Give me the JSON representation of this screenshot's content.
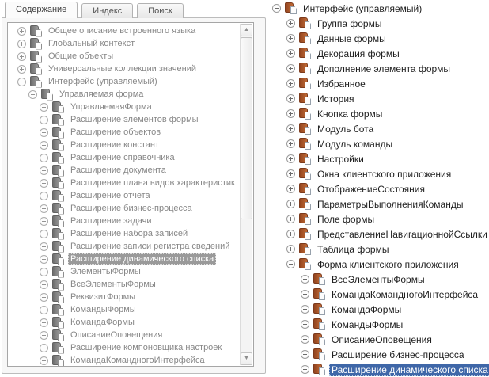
{
  "colors": {
    "selection_blue": "#3F67A8",
    "selection_gray": "#9A9A9A",
    "icon_orange": "#B45F2F",
    "icon_gray": "#7E7E7E",
    "left_text": "#878787",
    "right_text": "#1F1F1F"
  },
  "icons": {
    "up_arrow": "▲",
    "down_arrow": "▼"
  },
  "left_panel": {
    "tabs": [
      {
        "label": "Содержание",
        "active": true
      },
      {
        "label": "Индекс",
        "active": false
      },
      {
        "label": "Поиск",
        "active": false
      }
    ],
    "tree": {
      "items": [
        {
          "label": "Общее описание встроенного языка",
          "level": 0,
          "expand": "plus"
        },
        {
          "label": "Глобальный контекст",
          "level": 0,
          "expand": "plus"
        },
        {
          "label": "Общие объекты",
          "level": 0,
          "expand": "plus"
        },
        {
          "label": "Универсальные коллекции значений",
          "level": 0,
          "expand": "plus"
        },
        {
          "label": "Интерфейс (управляемый)",
          "level": 0,
          "expand": "minus"
        },
        {
          "label": "Управляемая форма",
          "level": 1,
          "expand": "minus"
        },
        {
          "label": "УправляемаяФорма",
          "level": 2,
          "expand": "plus"
        },
        {
          "label": "Расширение элементов формы",
          "level": 2,
          "expand": "plus"
        },
        {
          "label": "Расширение объектов",
          "level": 2,
          "expand": "plus"
        },
        {
          "label": "Расширение констант",
          "level": 2,
          "expand": "plus"
        },
        {
          "label": "Расширение справочника",
          "level": 2,
          "expand": "plus"
        },
        {
          "label": "Расширение документа",
          "level": 2,
          "expand": "plus"
        },
        {
          "label": "Расширение плана видов характеристик",
          "level": 2,
          "expand": "plus"
        },
        {
          "label": "Расширение отчета",
          "level": 2,
          "expand": "plus"
        },
        {
          "label": "Расширение бизнес-процесса",
          "level": 2,
          "expand": "plus"
        },
        {
          "label": "Расширение задачи",
          "level": 2,
          "expand": "plus"
        },
        {
          "label": "Расширение набора записей",
          "level": 2,
          "expand": "plus"
        },
        {
          "label": "Расширение записи регистра сведений",
          "level": 2,
          "expand": "plus"
        },
        {
          "label": "Расширение динамического списка",
          "level": 2,
          "expand": "plus",
          "selected": true
        },
        {
          "label": "ЭлементыФормы",
          "level": 2,
          "expand": "plus"
        },
        {
          "label": "ВсеЭлементыФормы",
          "level": 2,
          "expand": "plus"
        },
        {
          "label": "РеквизитФормы",
          "level": 2,
          "expand": "plus"
        },
        {
          "label": "КомандыФормы",
          "level": 2,
          "expand": "plus"
        },
        {
          "label": "КомандаФормы",
          "level": 2,
          "expand": "plus"
        },
        {
          "label": "ОписаниеОповещения",
          "level": 2,
          "expand": "plus"
        },
        {
          "label": "Расширение компоновщика настроек",
          "level": 2,
          "expand": "plus"
        },
        {
          "label": "КомандаКомандногоИнтерфейса",
          "level": 2,
          "expand": "plus"
        }
      ]
    }
  },
  "right_panel": {
    "tree": {
      "items": [
        {
          "label": "Интерфейс (управляемый)",
          "level": 0,
          "expand": "minus"
        },
        {
          "label": "Группа формы",
          "level": 1,
          "expand": "plus"
        },
        {
          "label": "Данные формы",
          "level": 1,
          "expand": "plus"
        },
        {
          "label": "Декорация формы",
          "level": 1,
          "expand": "plus"
        },
        {
          "label": "Дополнение элемента формы",
          "level": 1,
          "expand": "plus"
        },
        {
          "label": "Избранное",
          "level": 1,
          "expand": "plus"
        },
        {
          "label": "История",
          "level": 1,
          "expand": "plus"
        },
        {
          "label": "Кнопка формы",
          "level": 1,
          "expand": "plus"
        },
        {
          "label": "Модуль бота",
          "level": 1,
          "expand": "plus"
        },
        {
          "label": "Модуль команды",
          "level": 1,
          "expand": "plus"
        },
        {
          "label": "Настройки",
          "level": 1,
          "expand": "plus"
        },
        {
          "label": "Окна клиентского приложения",
          "level": 1,
          "expand": "plus"
        },
        {
          "label": "ОтображениеСостояния",
          "level": 1,
          "expand": "plus"
        },
        {
          "label": "ПараметрыВыполненияКоманды",
          "level": 1,
          "expand": "plus"
        },
        {
          "label": "Поле формы",
          "level": 1,
          "expand": "plus"
        },
        {
          "label": "ПредставлениеНавигационнойСсылки",
          "level": 1,
          "expand": "plus"
        },
        {
          "label": "Таблица формы",
          "level": 1,
          "expand": "plus"
        },
        {
          "label": "Форма клиентского приложения",
          "level": 1,
          "expand": "minus"
        },
        {
          "label": "ВсеЭлементыФормы",
          "level": 2,
          "expand": "plus"
        },
        {
          "label": "КомандаКомандногоИнтерфейса",
          "level": 2,
          "expand": "plus"
        },
        {
          "label": "КомандаФормы",
          "level": 2,
          "expand": "plus"
        },
        {
          "label": "КомандыФормы",
          "level": 2,
          "expand": "plus"
        },
        {
          "label": "ОписаниеОповещения",
          "level": 2,
          "expand": "plus"
        },
        {
          "label": "Расширение бизнес-процесса",
          "level": 2,
          "expand": "plus"
        },
        {
          "label": "Расширение динамического списка",
          "level": 2,
          "expand": "plus",
          "selected": true
        }
      ]
    }
  }
}
